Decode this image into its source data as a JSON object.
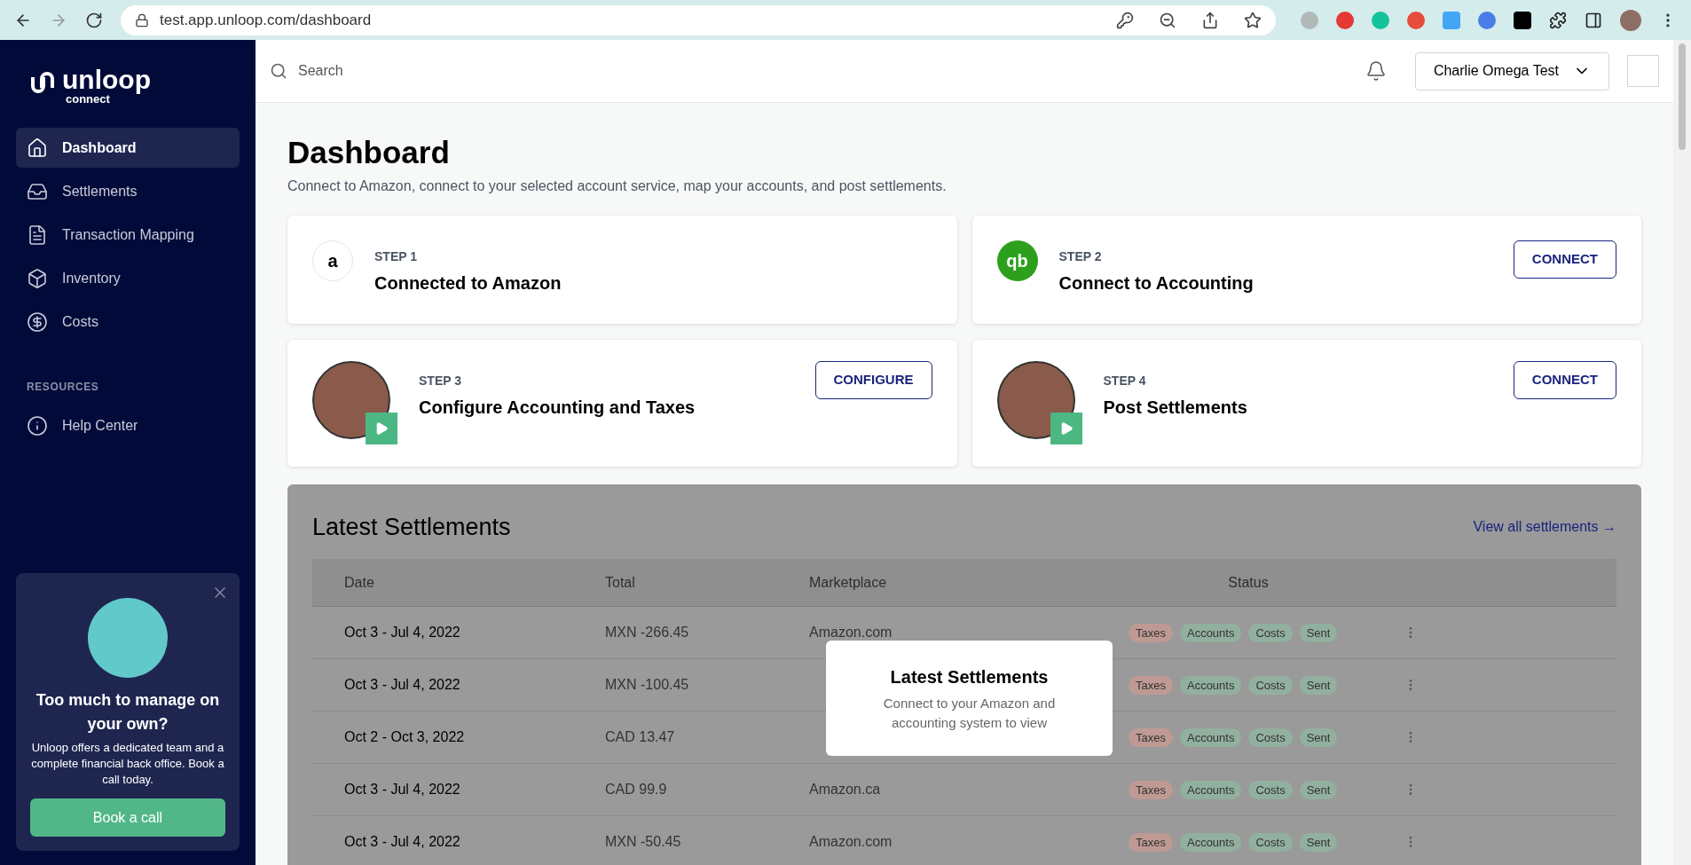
{
  "browser": {
    "url": "test.app.unloop.com/dashboard"
  },
  "sidebar": {
    "logo": {
      "name": "unloop",
      "tagline": "connect"
    },
    "items": [
      {
        "label": "Dashboard",
        "selected": true
      },
      {
        "label": "Settlements",
        "selected": false
      },
      {
        "label": "Transaction Mapping",
        "selected": false
      },
      {
        "label": "Inventory",
        "selected": false
      },
      {
        "label": "Costs",
        "selected": false
      }
    ],
    "section_label": "RESOURCES",
    "resources": [
      {
        "label": "Help Center",
        "selected": false
      }
    ],
    "promo": {
      "title": "Too much to manage on your own?",
      "body": "Unloop offers a dedicated team and a complete financial back office. Book a call today.",
      "button": "Book a call"
    }
  },
  "header": {
    "search": {
      "placeholder": "Search"
    },
    "account": "Charlie Omega Test"
  },
  "page": {
    "title": "Dashboard",
    "subtitle": "Connect to Amazon, connect to your selected account service, map your accounts, and post settlements."
  },
  "steps": [
    {
      "kind": "amazon",
      "logo_text": "a",
      "step": "STEP 1",
      "title": "Connected to Amazon"
    },
    {
      "kind": "quickbooks",
      "logo_text": "qb",
      "step": "STEP 2",
      "title": "Connect to Accounting",
      "button": "CONNECT"
    },
    {
      "kind": "video",
      "step": "STEP 3",
      "title": "Configure Accounting and Taxes",
      "button": "CONFIGURE"
    },
    {
      "kind": "video",
      "step": "STEP 4",
      "title": "Post Settlements",
      "button": "CONNECT"
    }
  ],
  "settlements": {
    "title": "Latest Settlements",
    "link": "View all settlements →",
    "columns": [
      "Date",
      "Total",
      "Marketplace",
      "Status"
    ],
    "rows": [
      {
        "date": "Oct 3 - Jul 4, 2022",
        "total": "MXN -266.45",
        "marketplace": "Amazon.com",
        "tags": [
          {
            "label": "Taxes",
            "color": "#bf9a94"
          },
          {
            "label": "Accounts",
            "color": "#92b09f"
          },
          {
            "label": "Costs",
            "color": "#92b09f"
          },
          {
            "label": "Sent",
            "color": "#92b09f"
          }
        ]
      },
      {
        "date": "Oct 3 - Jul 4, 2022",
        "total": "MXN -100.45",
        "tags": [
          {
            "label": "Taxes",
            "color": "#bf9a94"
          },
          {
            "label": "Accounts",
            "color": "#92b09f"
          },
          {
            "label": "Costs",
            "color": "#92b09f"
          },
          {
            "label": "Sent",
            "color": "#92b09f"
          }
        ]
      },
      {
        "date": "Oct 2 - Oct 3, 2022",
        "total": "CAD 13.47",
        "tags": [
          {
            "label": "Taxes",
            "color": "#bf9a94"
          },
          {
            "label": "Accounts",
            "color": "#92b09f"
          },
          {
            "label": "Costs",
            "color": "#92b09f"
          },
          {
            "label": "Sent",
            "color": "#92b09f"
          }
        ]
      },
      {
        "date": "Oct 3 - Jul 4, 2022",
        "total": "CAD 99.9",
        "marketplace": "Amazon.ca",
        "tags": [
          {
            "label": "Taxes",
            "color": "#bf9a94"
          },
          {
            "label": "Accounts",
            "color": "#92b09f"
          },
          {
            "label": "Costs",
            "color": "#92b09f"
          },
          {
            "label": "Sent",
            "color": "#92b09f"
          }
        ]
      },
      {
        "date": "Oct 3 - Jul 4, 2022",
        "total": "MXN -50.45",
        "marketplace": "Amazon.com",
        "tags": [
          {
            "label": "Taxes",
            "color": "#bf9a94"
          },
          {
            "label": "Accounts",
            "color": "#92b09f"
          },
          {
            "label": "Costs",
            "color": "#92b09f"
          },
          {
            "label": "Sent",
            "color": "#92b09f"
          }
        ]
      }
    ],
    "overlay": {
      "title": "Latest Settlements",
      "body": "Connect to your Amazon and accounting system to view"
    }
  }
}
